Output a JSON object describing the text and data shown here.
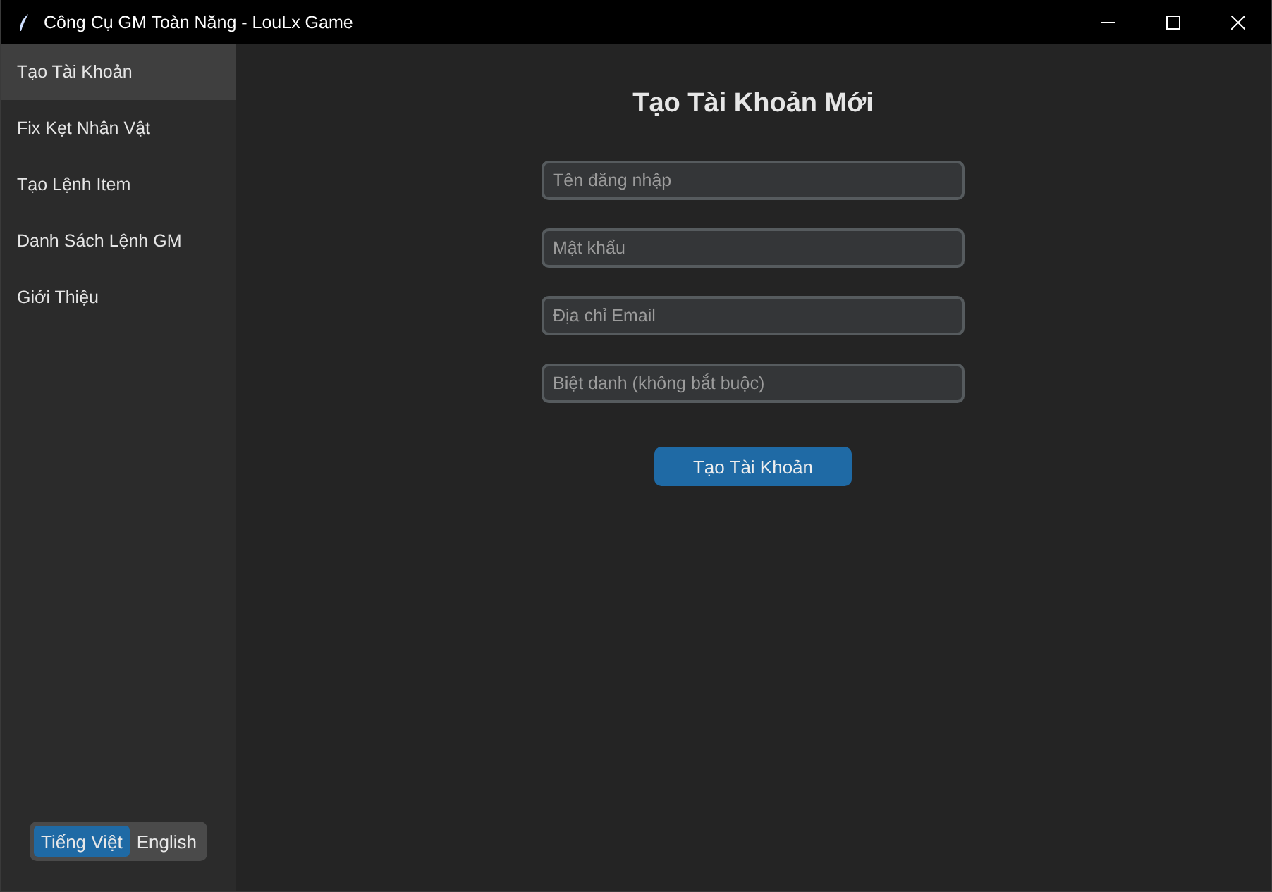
{
  "window": {
    "title": "Công Cụ GM Toàn Năng - LouLx Game"
  },
  "sidebar": {
    "items": [
      {
        "label": "Tạo Tài Khoản",
        "selected": true
      },
      {
        "label": "Fix Kẹt Nhân Vật",
        "selected": false
      },
      {
        "label": "Tạo Lệnh Item",
        "selected": false
      },
      {
        "label": "Danh Sách Lệnh GM",
        "selected": false
      },
      {
        "label": "Giới Thiệu",
        "selected": false
      }
    ],
    "languages": [
      {
        "label": "Tiếng Việt",
        "selected": true
      },
      {
        "label": "English",
        "selected": false
      }
    ]
  },
  "form": {
    "title": "Tạo Tài Khoản Mới",
    "fields": [
      {
        "placeholder": "Tên đăng nhập"
      },
      {
        "placeholder": "Mật khẩu"
      },
      {
        "placeholder": "Địa chỉ Email"
      },
      {
        "placeholder": "Biệt danh (không bắt buộc)"
      }
    ],
    "submit": "Tạo Tài Khoản"
  }
}
